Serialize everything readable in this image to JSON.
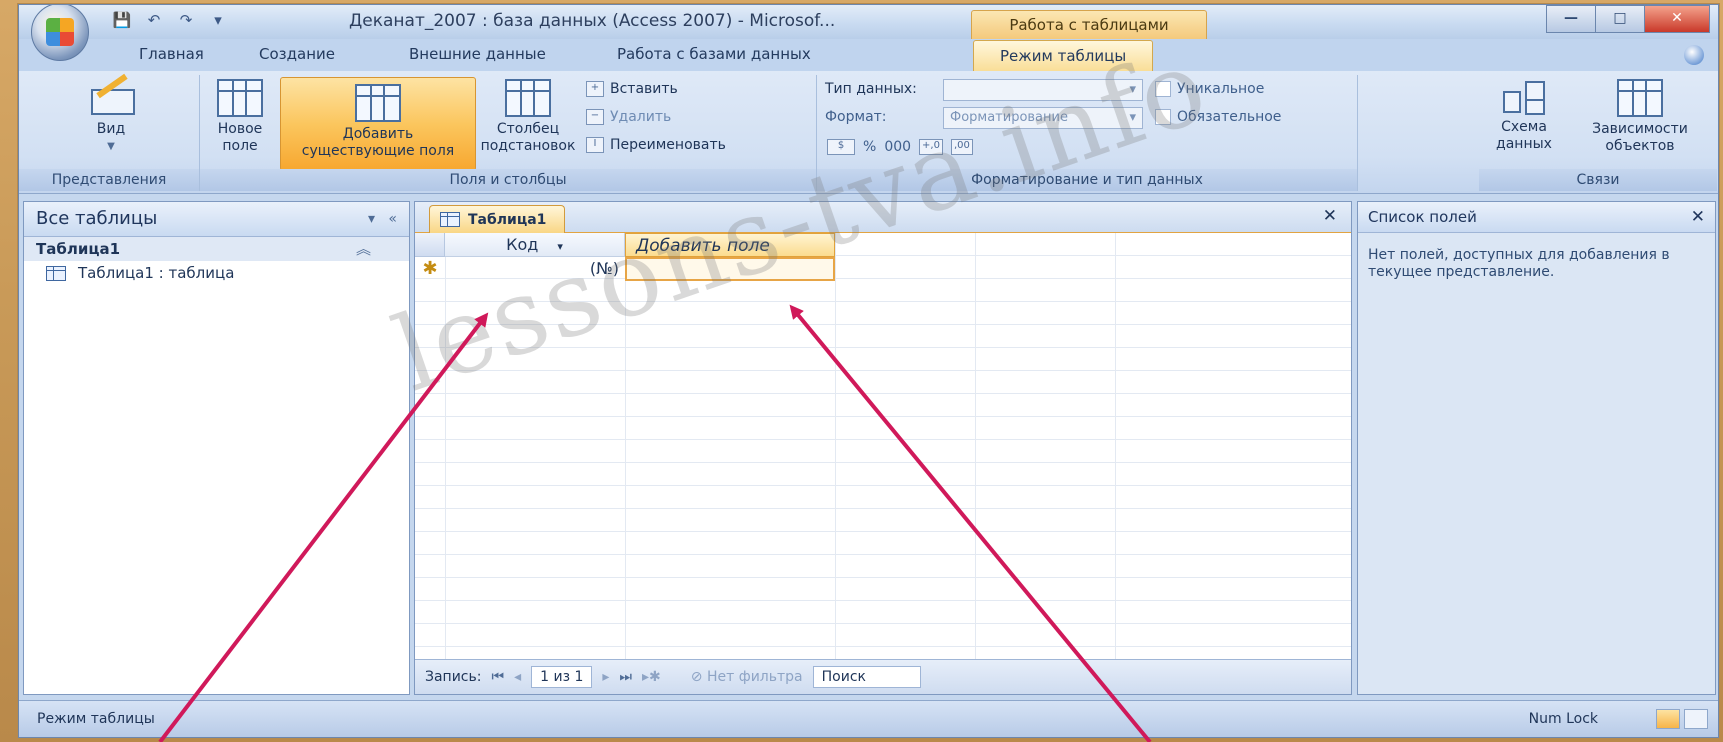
{
  "app": {
    "title": "Деканат_2007 : база данных (Access 2007) - Microsof...",
    "context_tab": "Работа с таблицами",
    "window_controls": {
      "minimize": "—",
      "maximize": "□",
      "close": "✕"
    },
    "help_icon": "help-icon"
  },
  "ribbon_tabs": [
    "Главная",
    "Создание",
    "Внешние данные",
    "Работа с базами данных",
    "Режим таблицы"
  ],
  "ribbon": {
    "views": {
      "label": "Представления",
      "vid": "Вид"
    },
    "fields": {
      "label": "Поля и столбцы",
      "new_field_l1": "Новое",
      "new_field_l2": "поле",
      "add_existing_l1": "Добавить",
      "add_existing_l2": "существующие поля",
      "lookup_l1": "Столбец",
      "lookup_l2": "подстановок",
      "insert": "Вставить",
      "delete": "Удалить",
      "rename": "Переименовать"
    },
    "format": {
      "label": "Форматирование и тип данных",
      "data_type_label": "Тип данных:",
      "format_label": "Формат:",
      "format_value": "Форматирование",
      "unique": "Уникальное",
      "required": "Обязательное",
      "percent": "%",
      "thousands": "000",
      "inc_dec": "+,0",
      "dec_dec": ",00"
    },
    "relations": {
      "label": "Связи",
      "schema_l1": "Схема",
      "schema_l2": "данных",
      "deps_l1": "Зависимости",
      "deps_l2": "объектов"
    }
  },
  "nav": {
    "header": "Все таблицы",
    "group": "Таблица1",
    "items": [
      {
        "label": "Таблица1 : таблица"
      }
    ]
  },
  "doc": {
    "tab": "Таблица1",
    "columns": {
      "kod": "Код",
      "add_field": "Добавить поле"
    },
    "new_row": {
      "marker": "✱",
      "kod_value": "(№)"
    },
    "record_nav": {
      "label": "Запись:",
      "position": "1 из 1",
      "filter": "Нет фильтра",
      "search": "Поиск"
    }
  },
  "field_list": {
    "header": "Список полей",
    "text": "Нет полей, доступных для добавления в текущее представление."
  },
  "status": {
    "left": "Режим таблицы",
    "right": "Num Lock"
  },
  "watermark": "lessons-tva.info",
  "colors": {
    "accent": "#f7a72f",
    "arrow": "#d0195a",
    "ribbon_bg": "#d2e0f3",
    "frame": "#c99a58"
  }
}
